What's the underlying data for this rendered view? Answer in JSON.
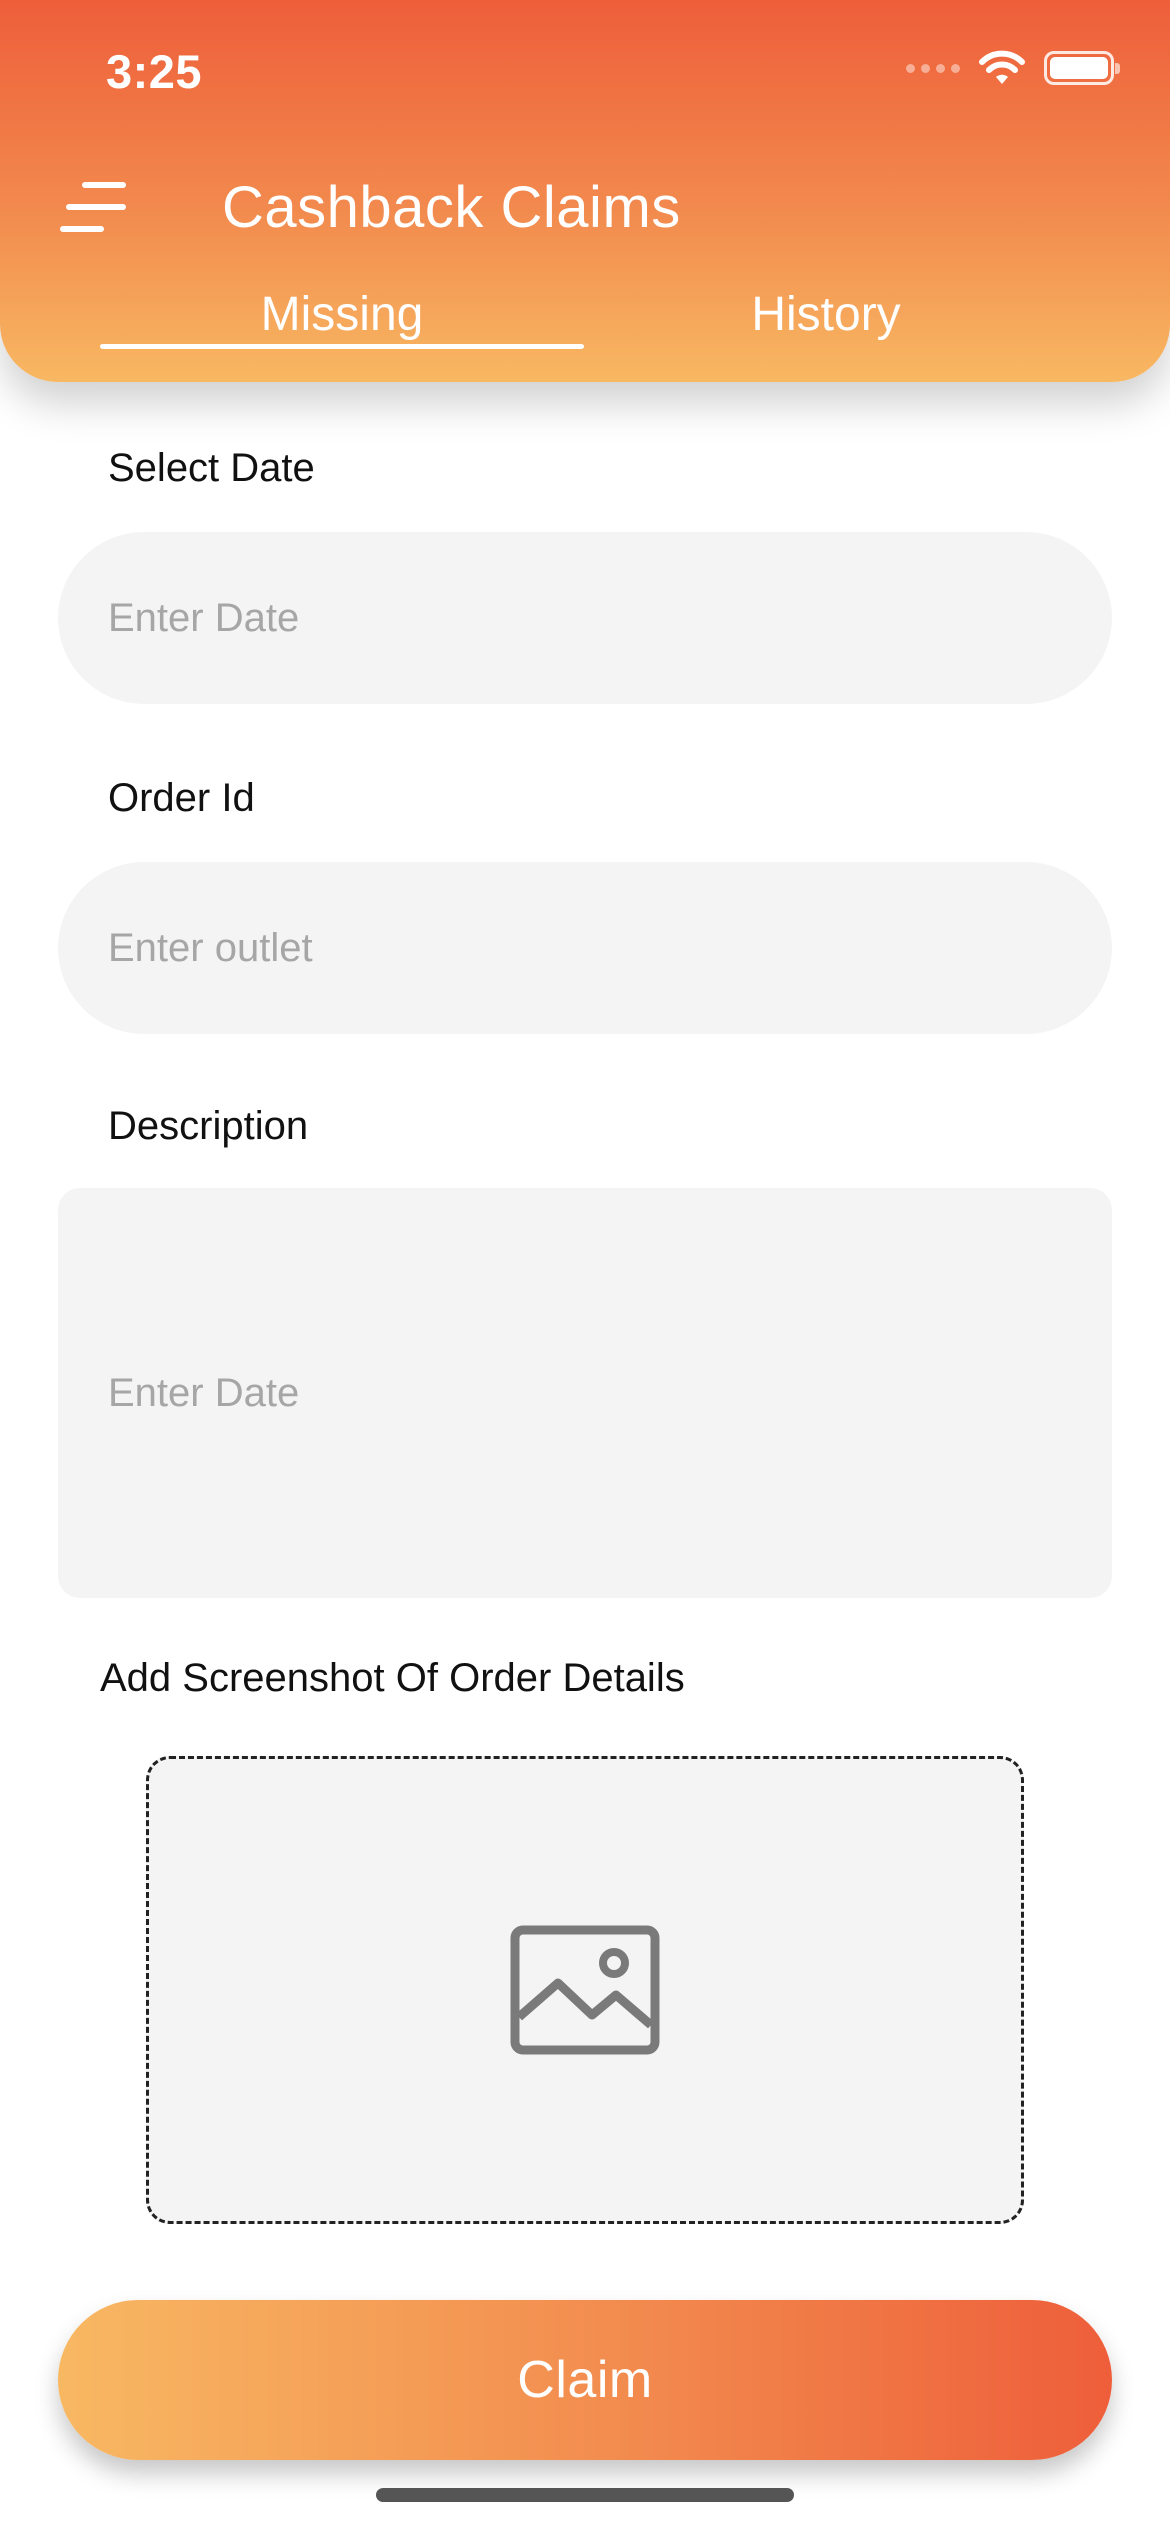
{
  "status_bar": {
    "time": "3:25"
  },
  "header": {
    "title": "Cashback Claims",
    "tabs": [
      {
        "label": "Missing",
        "active": true
      },
      {
        "label": "History",
        "active": false
      }
    ]
  },
  "form": {
    "date": {
      "label": "Select Date",
      "placeholder": "Enter Date"
    },
    "order_id": {
      "label": "Order Id",
      "placeholder": "Enter outlet"
    },
    "description": {
      "label": "Description",
      "placeholder": "Enter Date"
    },
    "screenshot": {
      "label": "Add Screenshot Of Order Details",
      "icon": "image-icon"
    }
  },
  "actions": {
    "claim_label": "Claim"
  },
  "colors": {
    "gradient_start": "#ee5e3a",
    "gradient_end": "#f8b862",
    "field_bg": "#f4f4f4",
    "placeholder": "#a6a6a6"
  }
}
